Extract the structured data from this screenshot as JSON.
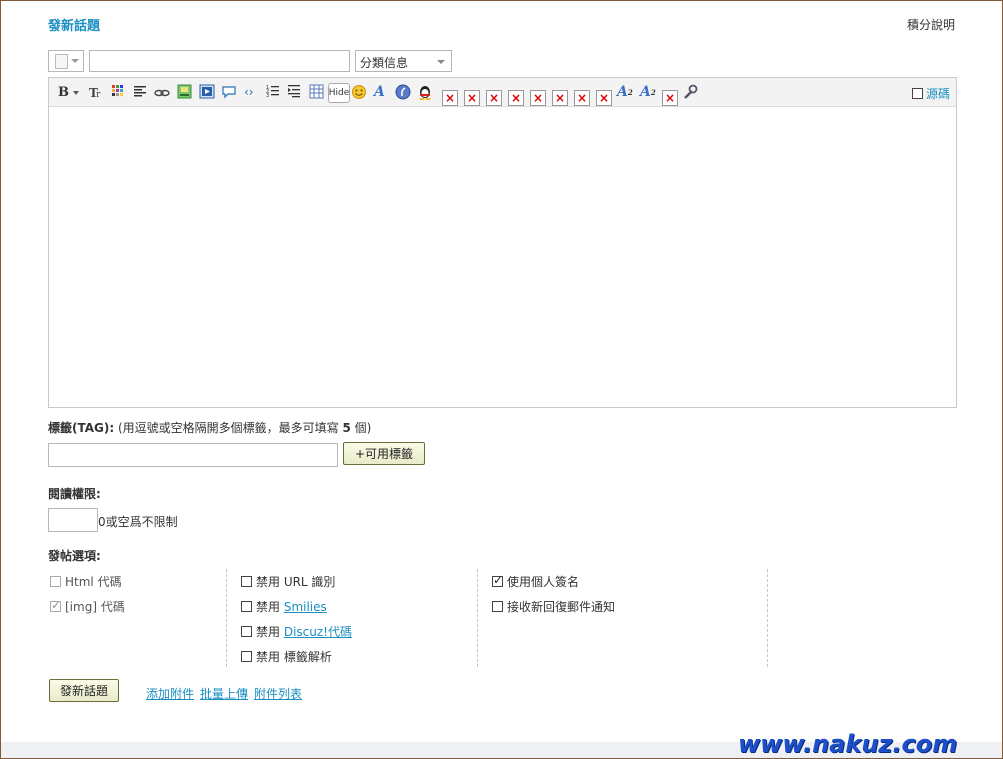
{
  "title": "發新話題",
  "help_link": "積分說明",
  "category_select": "分類信息",
  "toolbar": {
    "bold": "B",
    "source_label": "源碼"
  },
  "tag": {
    "label_bold": "標籤(TAG):",
    "label_hint_prefix": " (用逗號或空格隔開多個標籤，最多可填寫 ",
    "label_hint_count": "5",
    "label_hint_suffix": " 個)",
    "button": "+可用標籤"
  },
  "permission": {
    "label": "閱讀權限:",
    "hint": "0或空爲不限制"
  },
  "options": {
    "label": "發帖選項:",
    "html": "Html 代碼",
    "img": "[img] 代碼",
    "disable_url": "禁用 URL 識別",
    "disable_smilies_prefix": "禁用 ",
    "disable_smilies_link": "Smilies",
    "disable_discuz_prefix": "禁用 ",
    "disable_discuz_link": "Discuz!代碼",
    "disable_tag": "禁用 標籤解析",
    "use_signature": "使用個人簽名",
    "email_notify": "接收新回復郵件通知"
  },
  "submit": "發新話題",
  "attachments": {
    "add": "添加附件",
    "batch": "批量上傳",
    "list": "附件列表"
  },
  "watermark": "www.nakuz.com"
}
